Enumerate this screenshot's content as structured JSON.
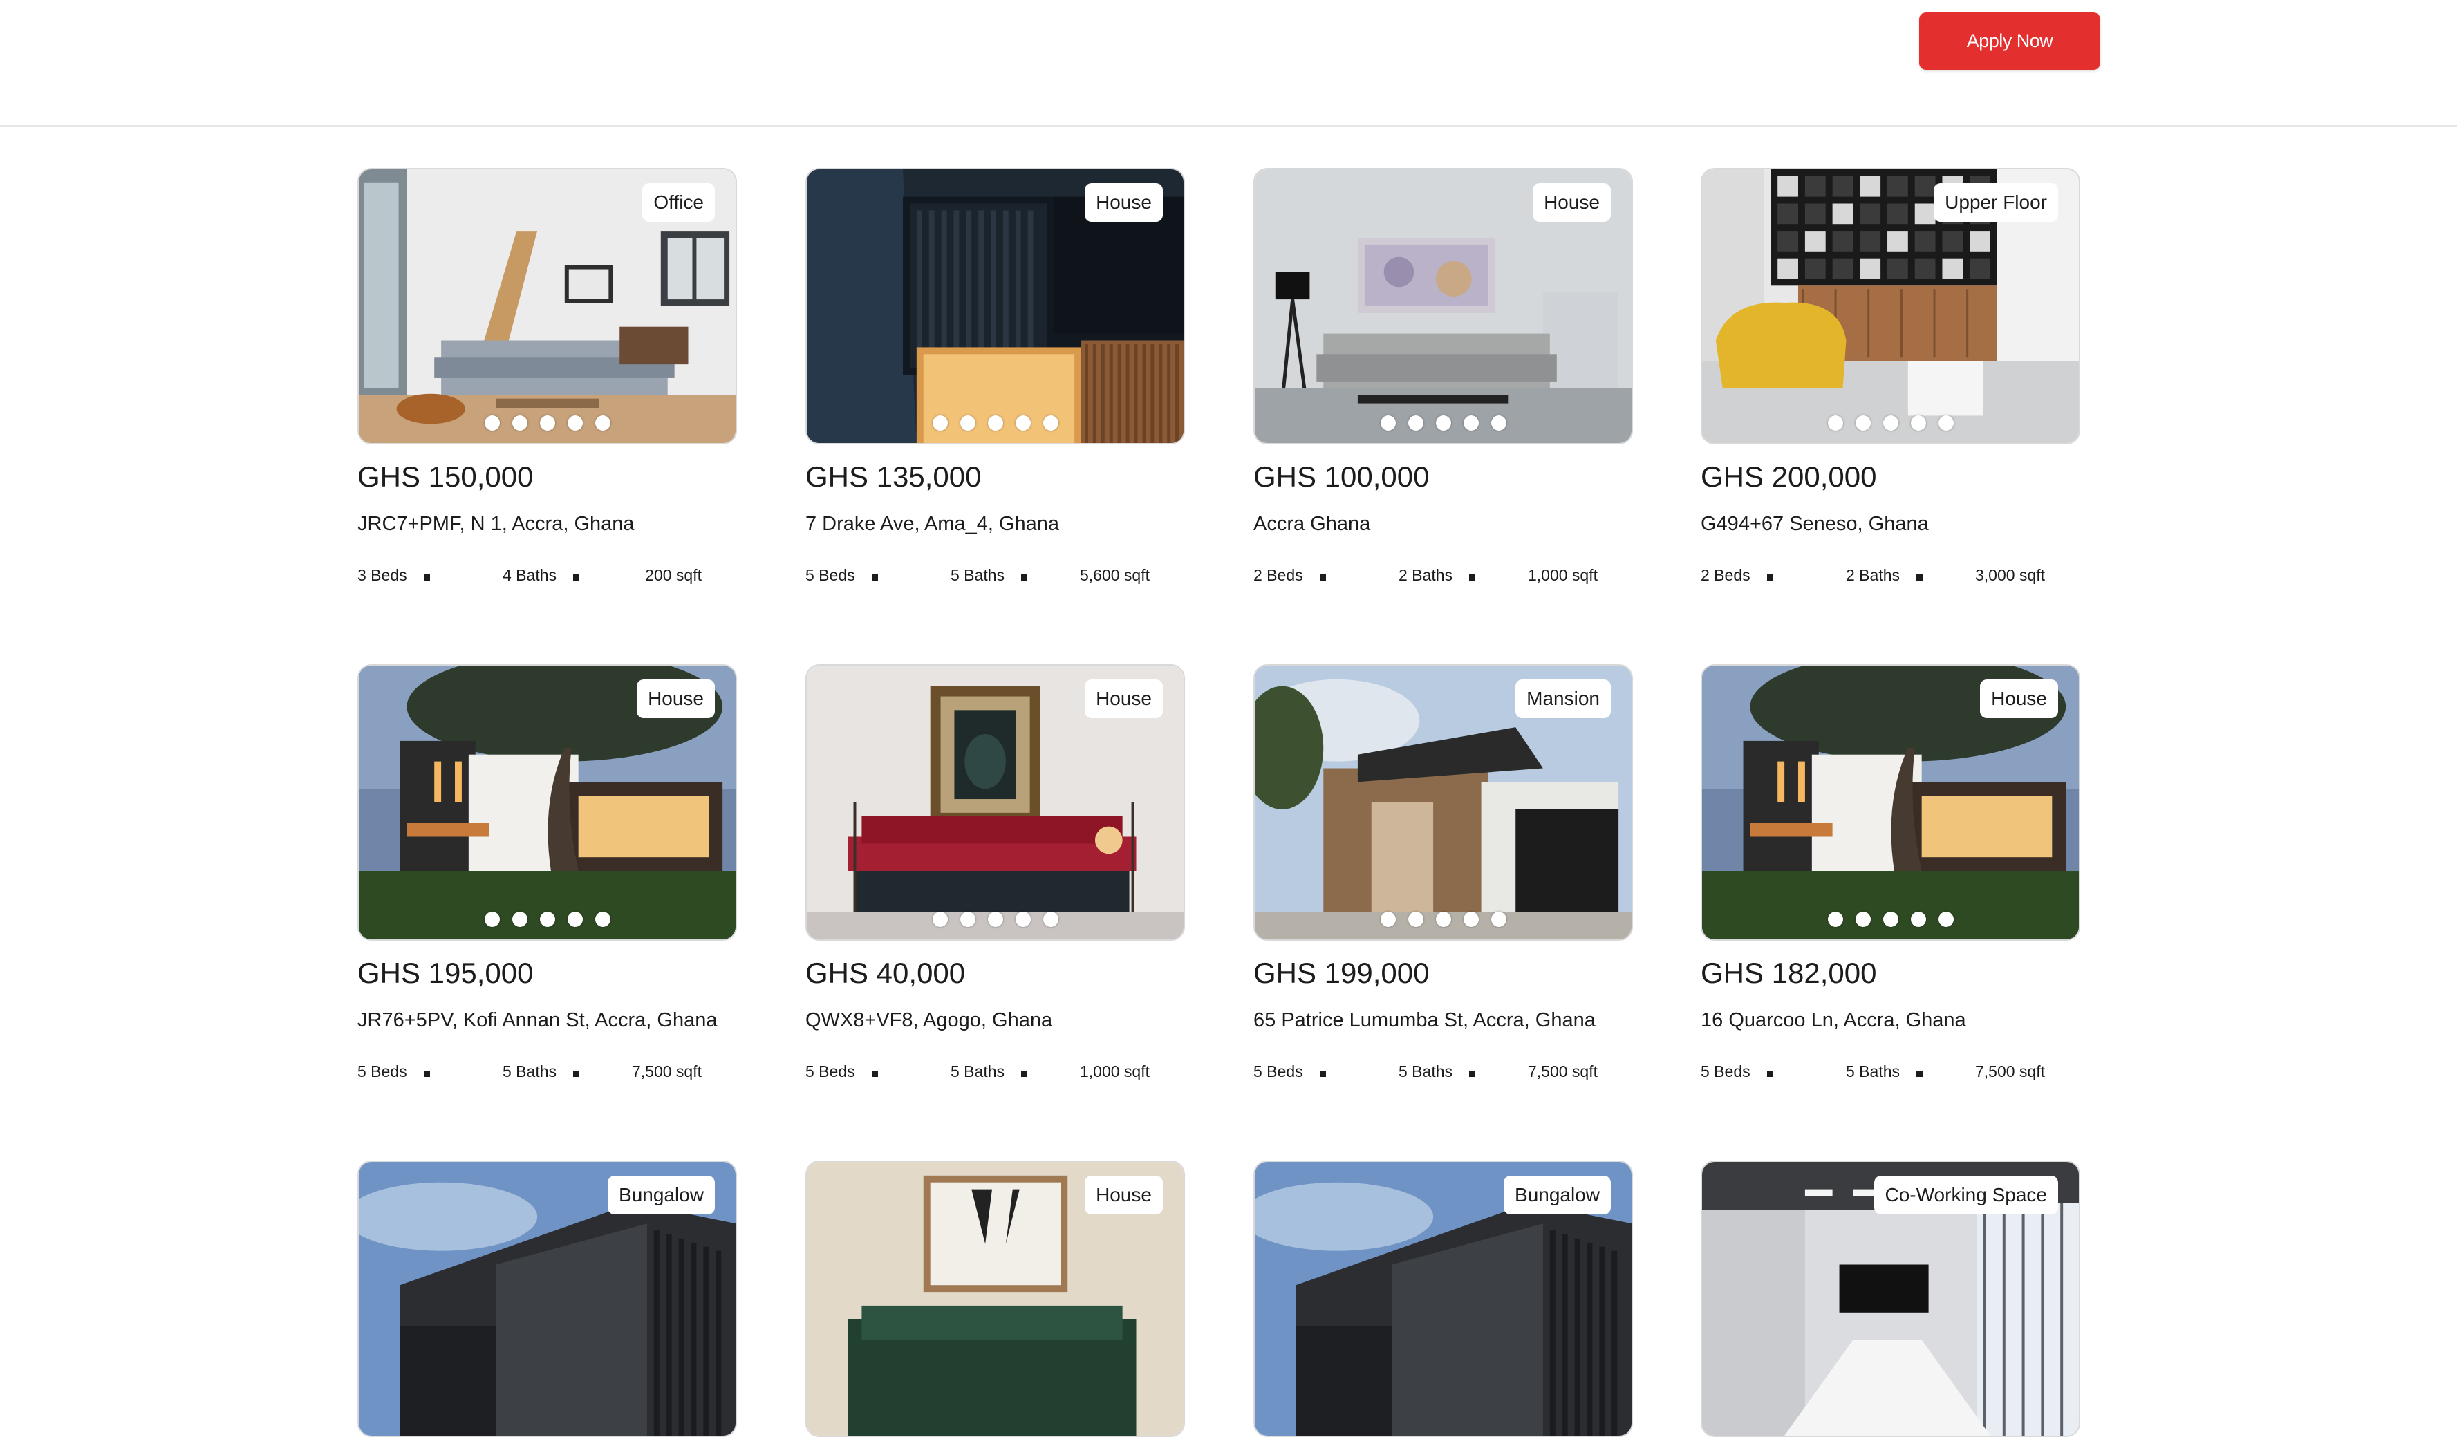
{
  "header": {
    "apply_label": "Apply Now"
  },
  "listings": [
    {
      "tag": "Office",
      "price": "GHS 150,000",
      "address": "JRC7+PMF, N 1, Accra, Ghana",
      "beds": "3 Beds",
      "baths": "4 Baths",
      "sqft": "200 sqft",
      "scene": "interior-living"
    },
    {
      "tag": "House",
      "price": "GHS 135,000",
      "address": "7 Drake Ave, Ama_4, Ghana",
      "beds": "5 Beds",
      "baths": "5 Baths",
      "sqft": "5,600 sqft",
      "scene": "modern-facade-night"
    },
    {
      "tag": "House",
      "price": "GHS 100,000",
      "address": "Accra Ghana",
      "beds": "2 Beds",
      "baths": "2 Baths",
      "sqft": "1,000 sqft",
      "scene": "grey-living-room"
    },
    {
      "tag": "Upper Floor",
      "price": "GHS 200,000",
      "address": "G494+67 Seneso, Ghana",
      "beds": "2 Beds",
      "baths": "2 Baths",
      "sqft": "3,000 sqft",
      "scene": "yellow-chair-kitchen"
    },
    {
      "tag": "House",
      "price": "GHS 195,000",
      "address": "JR76+5PV, Kofi Annan St, Accra, Ghana",
      "beds": "5 Beds",
      "baths": "5 Baths",
      "sqft": "7,500 sqft",
      "scene": "house-tree-dusk"
    },
    {
      "tag": "House",
      "price": "GHS 40,000",
      "address": "QWX8+VF8, Agogo, Ghana",
      "beds": "5 Beds",
      "baths": "5 Baths",
      "sqft": "1,000 sqft",
      "scene": "red-sofa-artwork"
    },
    {
      "tag": "Mansion",
      "price": "GHS 199,000",
      "address": "65 Patrice Lumumba St, Accra, Ghana",
      "beds": "5 Beds",
      "baths": "5 Baths",
      "sqft": "7,500 sqft",
      "scene": "mansion-daylight"
    },
    {
      "tag": "House",
      "price": "GHS 182,000",
      "address": "16 Quarcoo Ln, Accra, Ghana",
      "beds": "5 Beds",
      "baths": "5 Baths",
      "sqft": "7,500 sqft",
      "scene": "house-tree-dusk"
    },
    {
      "tag": "Bungalow",
      "scene": "office-building-sky"
    },
    {
      "tag": "House",
      "scene": "green-sofa-art"
    },
    {
      "tag": "Bungalow",
      "scene": "office-building-sky"
    },
    {
      "tag": "Co-Working Space",
      "scene": "meeting-room"
    }
  ],
  "carousel_dot_count": 5
}
